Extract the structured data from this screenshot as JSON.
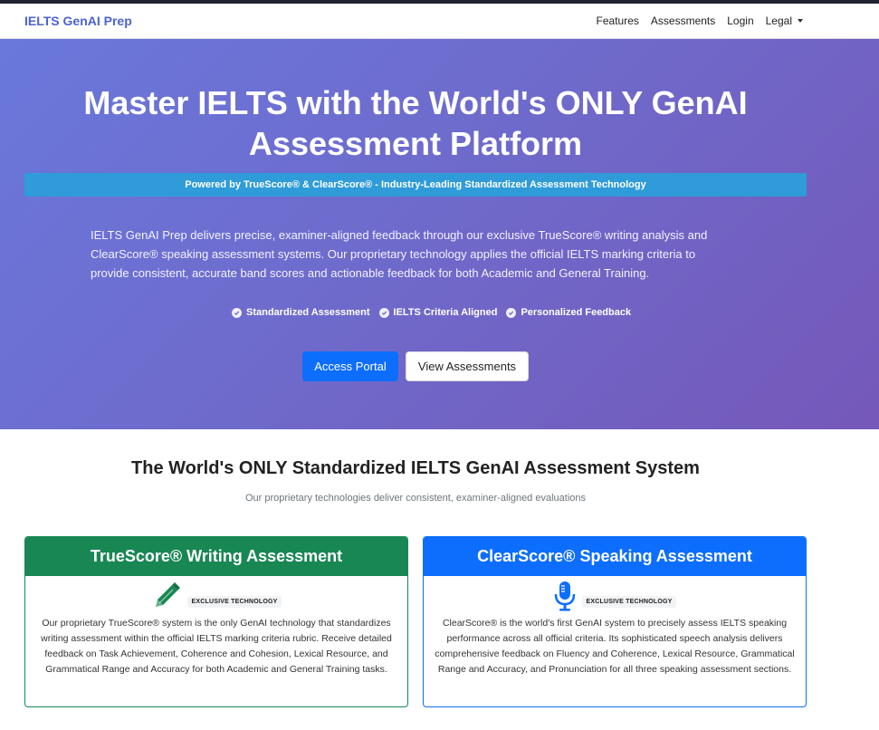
{
  "navbar": {
    "brand": "IELTS GenAI Prep",
    "links": [
      "Features",
      "Assessments",
      "Login",
      "Legal"
    ]
  },
  "hero": {
    "title": "Master IELTS with the World's ONLY GenAI Assessment Platform",
    "powered_by": "Powered by TrueScore® & ClearScore® - Industry-Leading Standardized Assessment Technology",
    "description": "IELTS GenAI Prep delivers precise, examiner-aligned feedback through our exclusive TrueScore® writing analysis and ClearScore® speaking assessment systems. Our proprietary technology applies the official IELTS marking criteria to provide consistent, accurate band scores and actionable feedback for both Academic and General Training.",
    "features": [
      "Standardized Assessment",
      "IELTS Criteria Aligned",
      "Personalized Feedback"
    ],
    "primary_button": "Access Portal",
    "secondary_button": "View Assessments"
  },
  "section": {
    "title": "The World's ONLY Standardized IELTS GenAI Assessment System",
    "subtitle": "Our proprietary technologies deliver consistent, examiner-aligned evaluations"
  },
  "cards": [
    {
      "title": "TrueScore® Writing Assessment",
      "icon": "pencil-icon",
      "badge": "EXCLUSIVE TECHNOLOGY",
      "text": "Our proprietary TrueScore® system is the only GenAI technology that standardizes writing assessment within the official IELTS marking criteria rubric. Receive detailed feedback on Task Achievement, Coherence and Cohesion, Lexical Resource, and Grammatical Range and Accuracy for both Academic and General Training tasks."
    },
    {
      "title": "ClearScore® Speaking Assessment",
      "icon": "microphone-icon",
      "badge": "EXCLUSIVE TECHNOLOGY",
      "text": "ClearScore® is the world's first GenAI system to precisely assess IELTS speaking performance across all official criteria. Its sophisticated speech analysis delivers comprehensive feedback on Fluency and Coherence, Lexical Resource, Grammatical Range and Accuracy, and Pronunciation for all three speaking assessment sections."
    }
  ],
  "colors": {
    "brand": "#4a63d6",
    "hero_gradient_start": "#6a78db",
    "hero_gradient_end": "#7558b9",
    "powered_bar": "#2f9bd9",
    "primary": "#0d6efd",
    "writing": "#198754",
    "speaking": "#0d6efd"
  }
}
